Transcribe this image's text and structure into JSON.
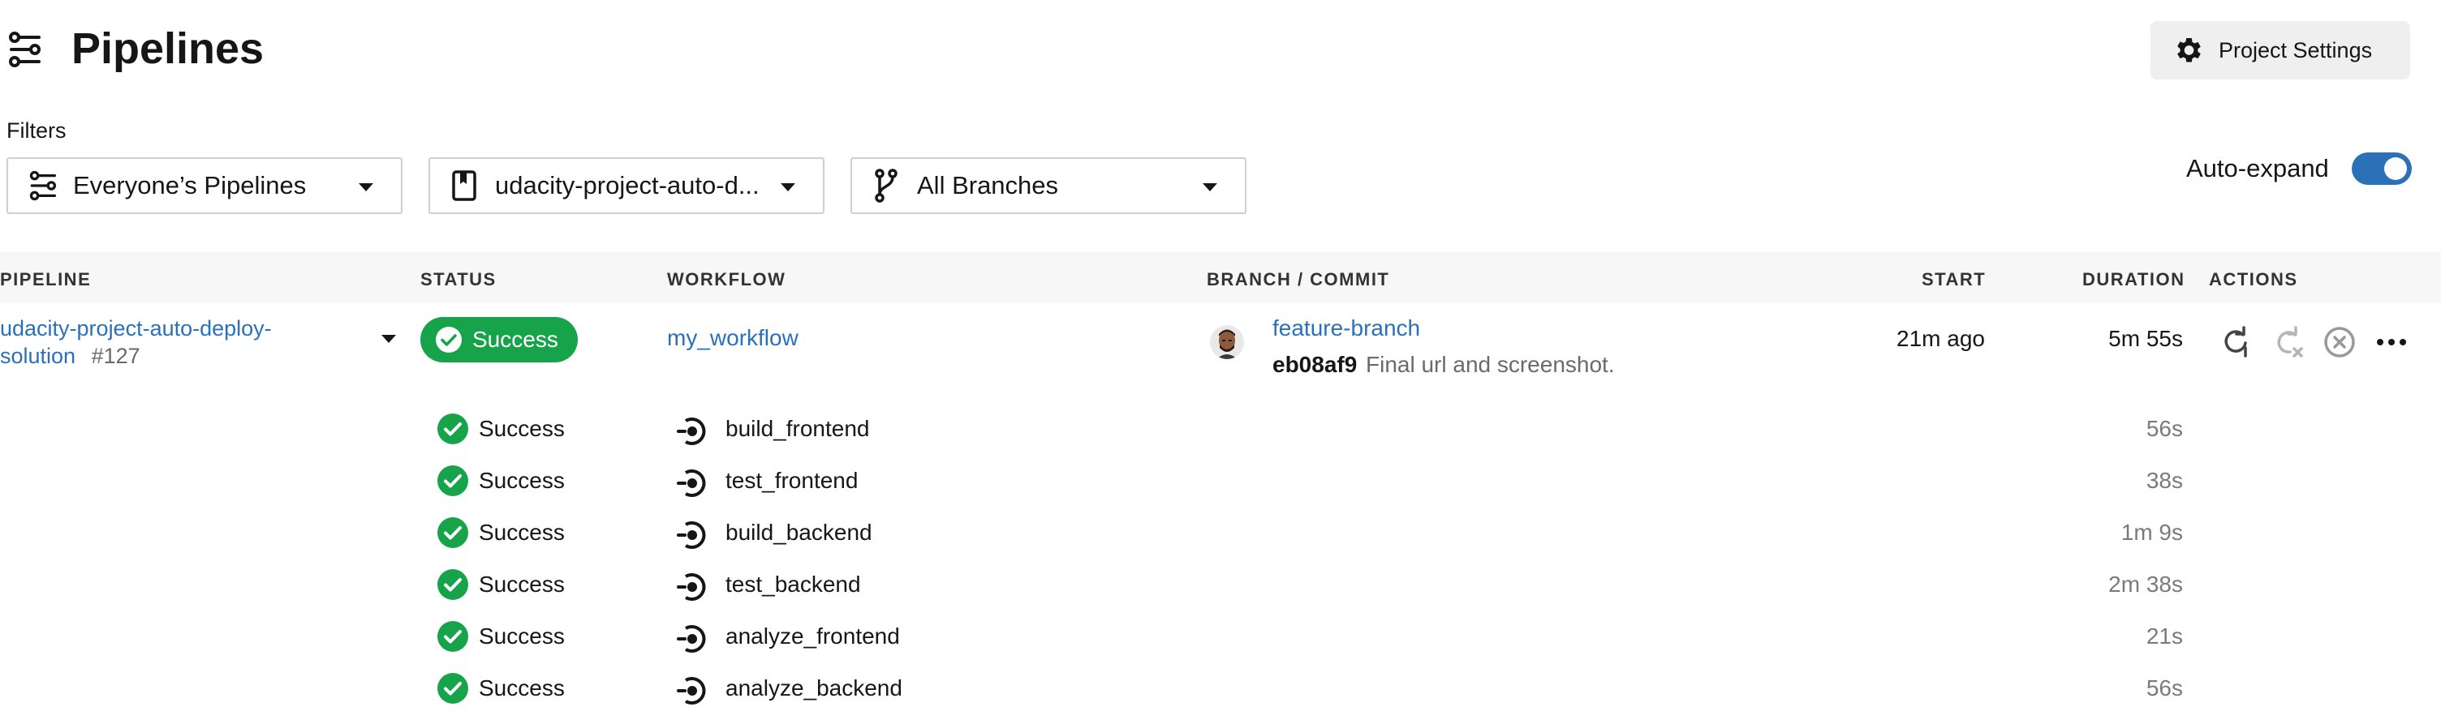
{
  "header": {
    "title": "Pipelines",
    "icon": "pipelines-icon",
    "project_settings_label": "Project Settings"
  },
  "filters": {
    "label": "Filters",
    "pipelines_filter": "Everyone’s Pipelines",
    "project_filter": "udacity-project-auto-d...",
    "branch_filter": "All Branches"
  },
  "auto_expand": {
    "label": "Auto-expand",
    "enabled": true
  },
  "columns": [
    "PIPELINE",
    "STATUS",
    "WORKFLOW",
    "BRANCH / COMMIT",
    "START",
    "DURATION",
    "ACTIONS"
  ],
  "pipeline": {
    "name_line1": "udacity-project-auto-deploy-",
    "name_line2": "solution",
    "number": "#127",
    "status": "Success",
    "workflow": "my_workflow",
    "branch": "feature-branch",
    "commit_hash": "eb08af9",
    "commit_message": "Final url and screenshot.",
    "start": "21m ago",
    "duration": "5m 55s",
    "actions": [
      "rerun-icon",
      "rerun-failed-icon",
      "cancel-icon",
      "more-icon"
    ]
  },
  "jobs": [
    {
      "status": "Success",
      "name": "build_frontend",
      "duration": "56s"
    },
    {
      "status": "Success",
      "name": "test_frontend",
      "duration": "38s"
    },
    {
      "status": "Success",
      "name": "build_backend",
      "duration": "1m 9s"
    },
    {
      "status": "Success",
      "name": "test_backend",
      "duration": "2m 38s"
    },
    {
      "status": "Success",
      "name": "analyze_frontend",
      "duration": "21s"
    },
    {
      "status": "Success",
      "name": "analyze_backend",
      "duration": "56s"
    }
  ],
  "colors": {
    "accent": "#2a71b8",
    "success": "#16a34a",
    "header_bg": "#f7f7f7"
  }
}
